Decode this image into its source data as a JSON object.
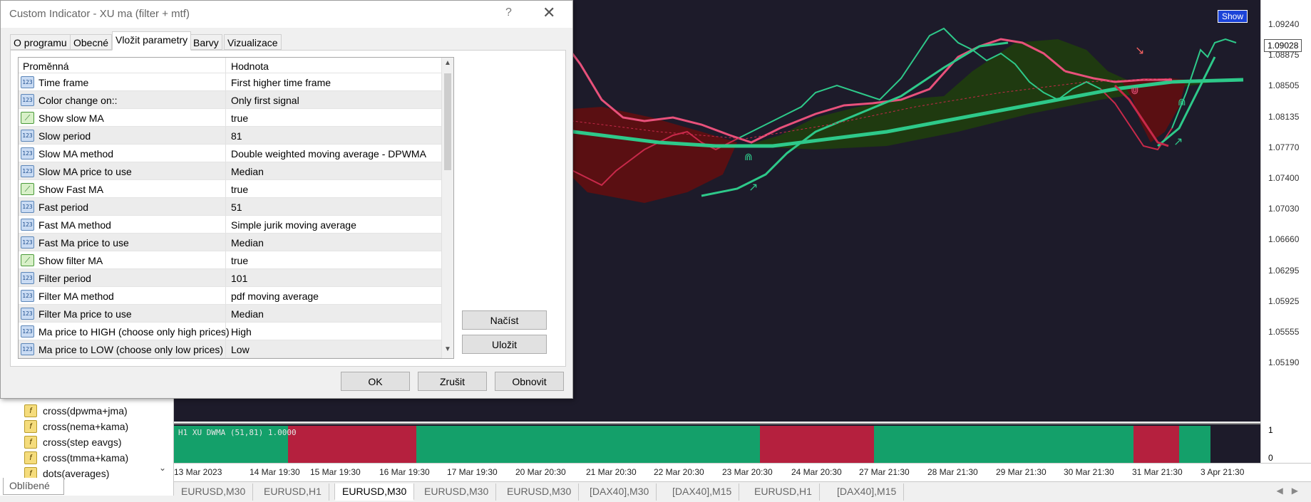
{
  "dialog": {
    "title": "Custom Indicator - XU ma (filter + mtf)",
    "help": "?",
    "close": "✕",
    "tabs": [
      "O programu",
      "Obecné",
      "Vložit parametry",
      "Barvy",
      "Vizualizace"
    ],
    "active_tab": "Vložit parametry",
    "grid": {
      "col_variable": "Proměnná",
      "col_value": "Hodnota",
      "rows": [
        {
          "name": "Time frame",
          "value": "First higher time frame",
          "type": "123"
        },
        {
          "name": "Color change on::",
          "value": "Only first signal",
          "type": "123"
        },
        {
          "name": "Show slow MA",
          "value": "true",
          "type": "bool"
        },
        {
          "name": "Slow period",
          "value": "81",
          "type": "123"
        },
        {
          "name": "Slow MA method",
          "value": "Double weighted moving average - DPWMA",
          "type": "123"
        },
        {
          "name": "Slow MA price to use",
          "value": "Median",
          "type": "123"
        },
        {
          "name": "Show Fast MA",
          "value": "true",
          "type": "bool"
        },
        {
          "name": "Fast period",
          "value": "51",
          "type": "123"
        },
        {
          "name": "Fast MA method",
          "value": "Simple jurik moving average",
          "type": "123"
        },
        {
          "name": "Fast Ma price to use",
          "value": "Median",
          "type": "123"
        },
        {
          "name": "Show filter MA",
          "value": "true",
          "type": "bool"
        },
        {
          "name": "Filter period",
          "value": "101",
          "type": "123"
        },
        {
          "name": "Filter MA method",
          "value": "pdf moving average",
          "type": "123"
        },
        {
          "name": "Filter Ma price to use",
          "value": "Median",
          "type": "123"
        },
        {
          "name": "Ma price to HIGH (choose only high prices)",
          "value": "High",
          "type": "123"
        },
        {
          "name": "Ma price to LOW (choose only low prices)",
          "value": "Low",
          "type": "123"
        }
      ]
    },
    "load_button": "Načíst",
    "save_button": "Uložit",
    "ok_button": "OK",
    "cancel_button": "Zrušit",
    "reset_button": "Obnovit"
  },
  "navigator": {
    "items": [
      "cross(dpwma+jma)",
      "cross(nema+kama)",
      "cross(step eavgs)",
      "cross(tmma+kama)",
      "dots(averages)"
    ],
    "favorites_tab": "Oblíbené"
  },
  "chart": {
    "show_button": "Show",
    "current_price": "1.09028",
    "price_ticks": [
      "1.09240",
      "1.08875",
      "1.08505",
      "1.08135",
      "1.07770",
      "1.07400",
      "1.07030",
      "1.06660",
      "1.06295",
      "1.05925",
      "1.05555",
      "1.05190"
    ],
    "subwindow_title": "H1 XU DWMA (51,81) 1.0000",
    "subwindow_levels": [
      "1",
      "0"
    ],
    "time_labels": [
      "13 Mar 2023",
      "14 Mar 19:30",
      "15 Mar 19:30",
      "16 Mar 19:30",
      "17 Mar 19:30",
      "20 Mar 20:30",
      "21 Mar 20:30",
      "22 Mar 20:30",
      "23 Mar 20:30",
      "24 Mar 20:30",
      "27 Mar 21:30",
      "28 Mar 21:30",
      "29 Mar 21:30",
      "30 Mar 21:30",
      "31 Mar 21:30",
      "3 Apr 21:30"
    ],
    "colors": {
      "background": "#1d1b2a",
      "bull": "#2ec98a",
      "bear": "#c8294a",
      "fill_bull": "#1f3a10",
      "fill_bear": "#5a0f12"
    }
  },
  "symbol_tabs": [
    "EURUSD,M30",
    "EURUSD,H1",
    "EURUSD,M30",
    "EURUSD,M30",
    "EURUSD,M30",
    "[DAX40],M30",
    "[DAX40],M15",
    "EURUSD,H1",
    "[DAX40],M15"
  ],
  "active_symbol_tab": 2
}
